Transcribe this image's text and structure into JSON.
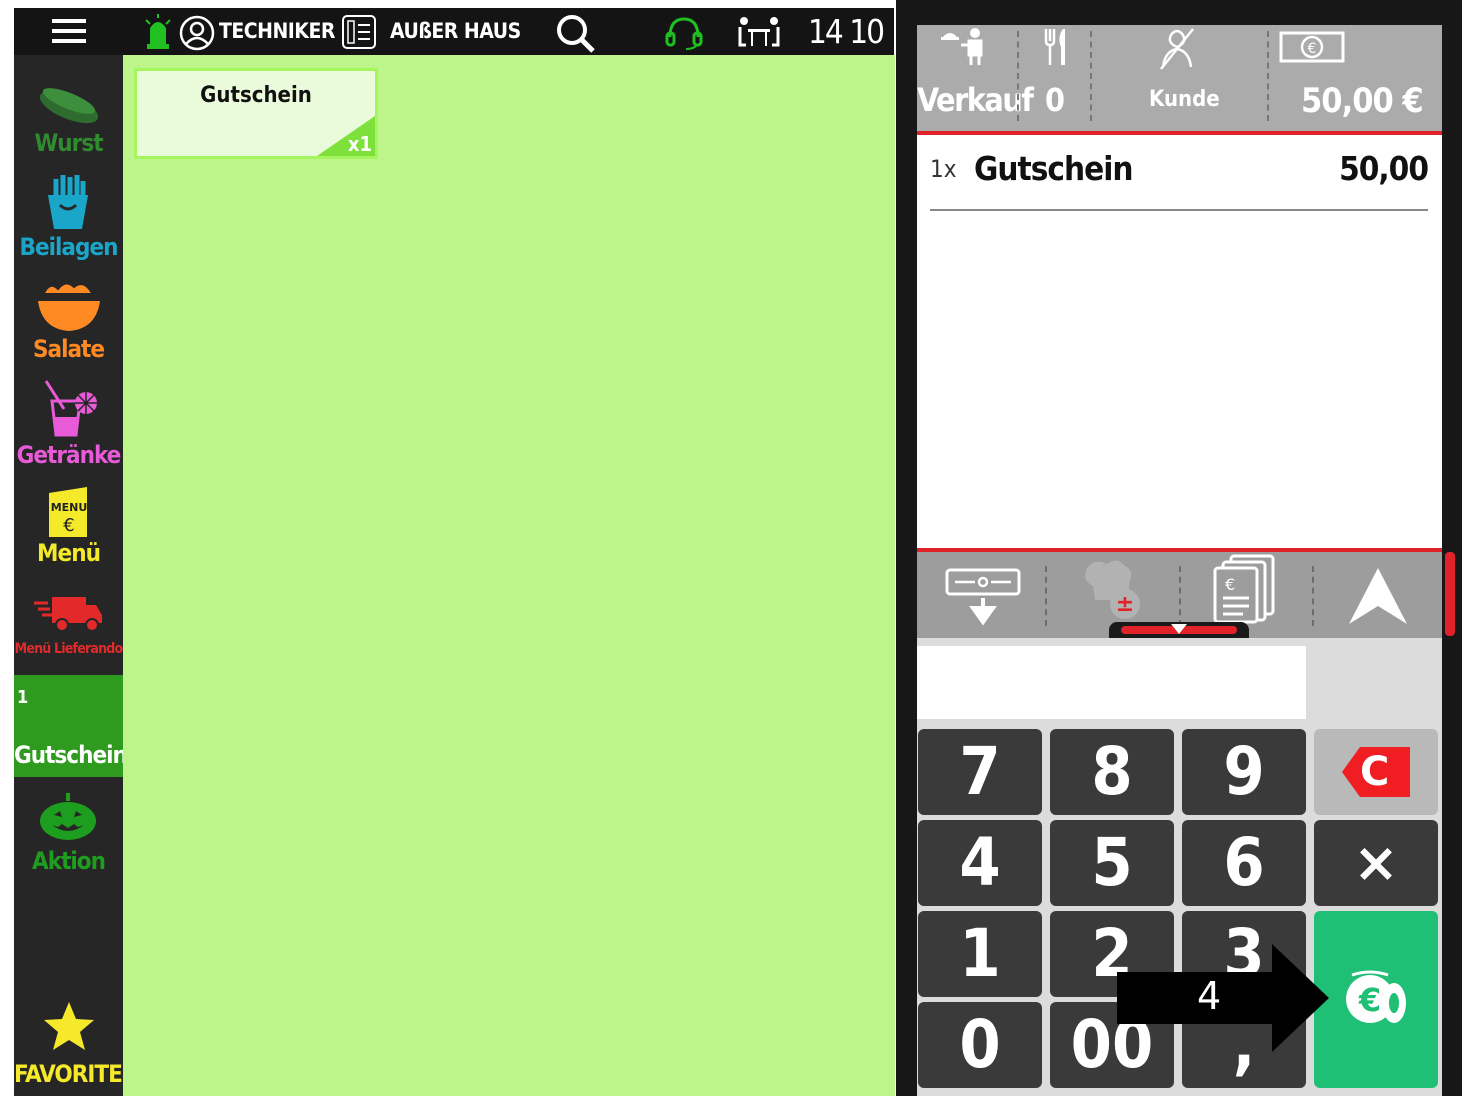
{
  "topbar": {
    "user": "TECHNIKER",
    "mode": "AUßER HAUS",
    "table_number": "14 10",
    "icons": [
      "menu-icon",
      "alarm-icon",
      "user-icon",
      "list-icon",
      "search-icon",
      "headset-icon",
      "table-icon"
    ]
  },
  "sidebar": {
    "items": [
      {
        "label": "Wurst",
        "color": "#2e8b2e",
        "icon": "sausage-icon"
      },
      {
        "label": "Beilagen",
        "color": "#1aa6c9",
        "icon": "fries-icon"
      },
      {
        "label": "Salate",
        "color": "#ff8a24",
        "icon": "salad-bowl-icon"
      },
      {
        "label": "Getränke",
        "color": "#e85ad8",
        "icon": "drink-icon"
      },
      {
        "label": "Menü",
        "color": "#f4ea2a",
        "icon": "menu-card-icon",
        "icon_text_1": "MENU",
        "icon_text_2": "€"
      },
      {
        "label": "Menü Lieferando",
        "color": "#e22a2a",
        "icon": "delivery-truck-icon"
      },
      {
        "label": "Gutschein",
        "color": "#ffffff",
        "badge": "1",
        "active": true
      },
      {
        "label": "Aktion",
        "color": "#1e9e1e",
        "icon": "pumpkin-icon"
      }
    ],
    "favorites_label": "FAVORITEN"
  },
  "main": {
    "product": {
      "name": "Gutschein",
      "count": "x1"
    }
  },
  "order_header": {
    "sale_type": "Verkauf",
    "guests": "0",
    "customer": "Kunde",
    "total": "50,00 €"
  },
  "order_items": [
    {
      "qty": "1x",
      "name": "Gutschein",
      "price": "50,00"
    }
  ],
  "keypad": {
    "keys": [
      "7",
      "8",
      "9",
      "4",
      "5",
      "6",
      "1",
      "2",
      "3",
      "0",
      "00",
      ","
    ],
    "clear_label": "C",
    "multiply_label": "×"
  },
  "annotation": {
    "step": "4"
  },
  "colors": {
    "main_bg": "#bdf58a",
    "accent_red": "#e1222a",
    "pay_green": "#1fbf75"
  }
}
